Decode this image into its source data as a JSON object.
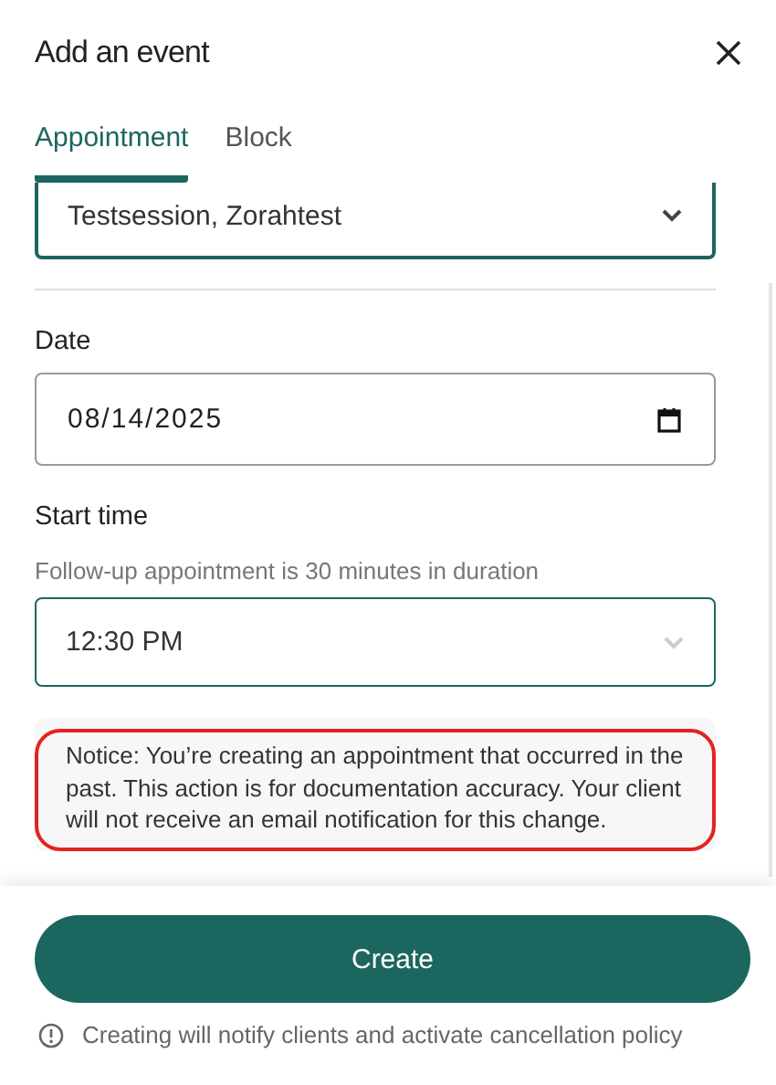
{
  "title": "Add an event",
  "tabs": [
    {
      "label": "Appointment",
      "selected": true
    },
    {
      "label": "Block",
      "selected": false
    }
  ],
  "client_select": {
    "value": "Testsession, Zorahtest"
  },
  "date": {
    "label": "Date",
    "value": "08/14/2025"
  },
  "start_time": {
    "label": "Start time",
    "hint": "Follow-up appointment is 30 minutes in duration",
    "value": "12:30 PM"
  },
  "notice": {
    "text": "Notice: You’re creating an appointment that occurred in the past. This action is for documentation accuracy. Your client will not receive an email notification for this change.",
    "highlighted": true
  },
  "create_button": "Create",
  "footnote": "Creating will notify clients and activate cancellation policy"
}
